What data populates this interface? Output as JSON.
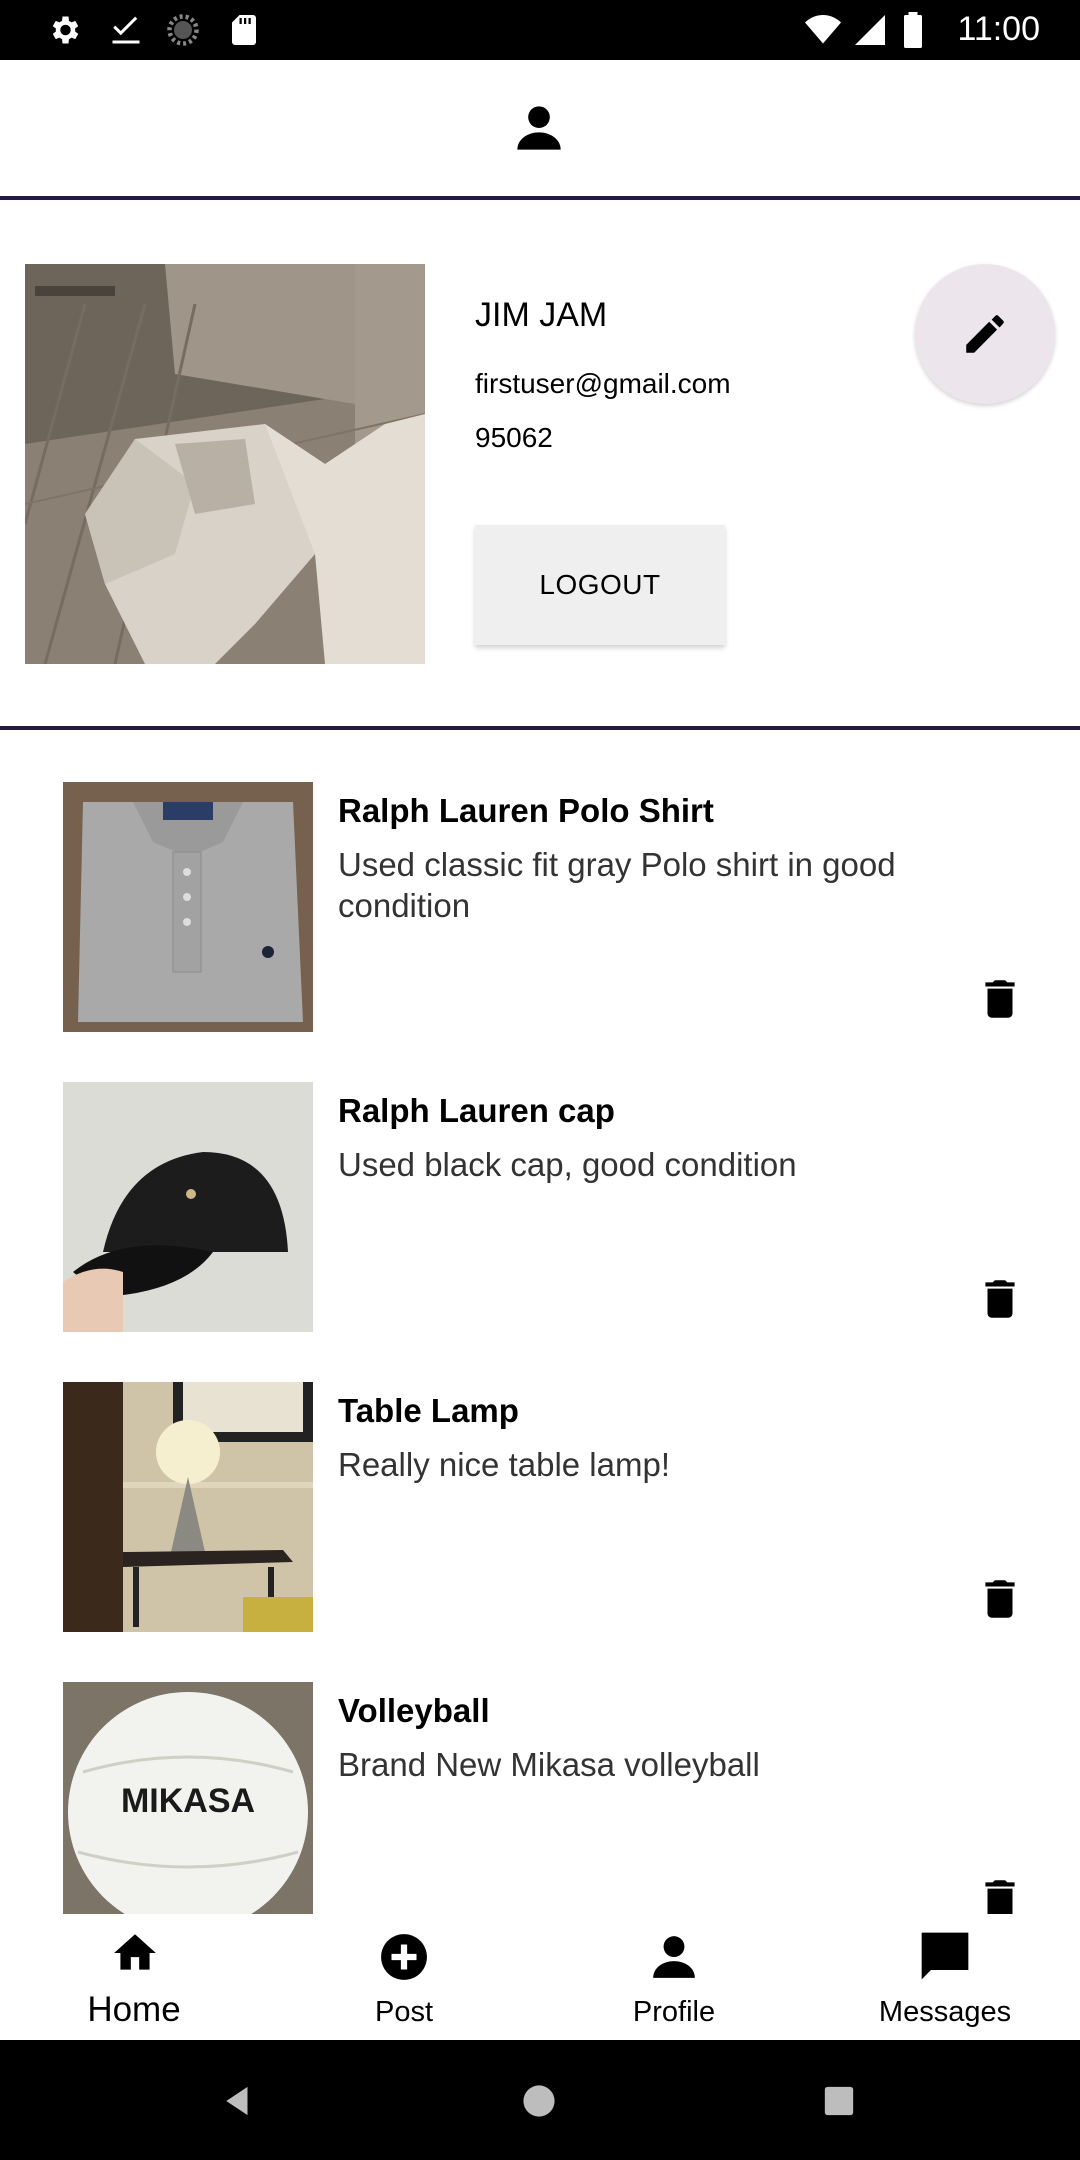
{
  "status_bar": {
    "time": "11:00"
  },
  "profile": {
    "name": "JIM JAM",
    "email": "firstuser@gmail.com",
    "zip": "95062",
    "logout_label": "LOGOUT"
  },
  "listings": [
    {
      "title": "Ralph Lauren Polo Shirt",
      "description": "Used classic fit gray Polo shirt in good condition"
    },
    {
      "title": "Ralph Lauren cap",
      "description": "Used black cap, good condition"
    },
    {
      "title": "Table Lamp",
      "description": "Really nice table lamp!"
    },
    {
      "title": "Volleyball",
      "description": "Brand New Mikasa volleyball"
    }
  ],
  "bottom_nav": {
    "home": "Home",
    "post": "Post",
    "profile": "Profile",
    "messages": "Messages"
  },
  "volleyball_brand": "MIKASA",
  "colors": {
    "divider": "#231942",
    "fab_bg": "#ede5ec",
    "logout_bg": "#efefef"
  }
}
